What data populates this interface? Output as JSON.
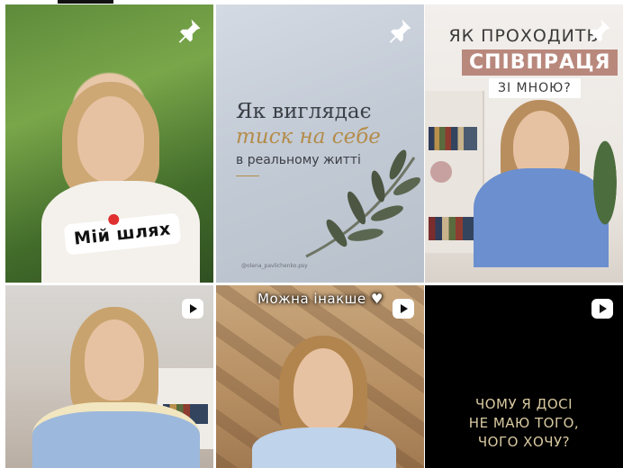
{
  "tiles": [
    {
      "kind": "pinned-photo",
      "tag": "Мій шлях"
    },
    {
      "kind": "pinned-post",
      "line1": "Як виглядає",
      "line2": "тиск на себе",
      "line3": "в реальному житті",
      "handle": "@olena_pavlichenko.psy"
    },
    {
      "kind": "pinned-post",
      "q1": "ЯК ПРОХОДИТЬ",
      "q2": "СПІВПРАЦЯ",
      "q3": "ЗІ МНОЮ?"
    },
    {
      "kind": "reel"
    },
    {
      "kind": "reel",
      "caption": "Можна інакше"
    },
    {
      "kind": "reel",
      "lines": [
        "ЧОМУ Я ДОСІ",
        "НЕ МАЮ ТОГО,",
        "ЧОГО ХОЧУ?"
      ]
    }
  ],
  "icons": {
    "pin": "pin-icon",
    "reel": "reel-play-icon"
  },
  "colors": {
    "accent": "#b9887d",
    "gold": "#b48c4a",
    "darkText": "#d8c9a0"
  }
}
